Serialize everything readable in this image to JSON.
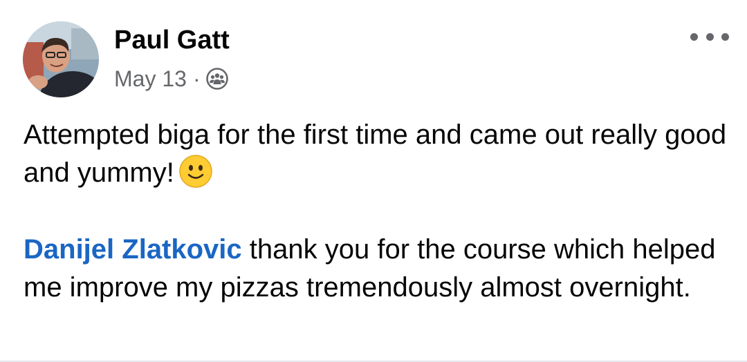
{
  "post": {
    "author": {
      "name": "Paul Gatt",
      "avatar_icon": "profile-photo"
    },
    "date": "May 13",
    "separator": "·",
    "audience_icon": "group-members-icon",
    "more_icon": "more-options-icon",
    "body": {
      "paragraph1": "Attempted biga for the first time and came out really good and yummy!",
      "paragraph1_emoji": "slightly-smiling-face",
      "mention": "Danijel Zlatkovic",
      "paragraph2": " thank you for the course which helped me improve my pizzas tremendously almost overnight."
    }
  },
  "colors": {
    "text": "#050505",
    "secondary_text": "#65676b",
    "mention": "#1a66c4",
    "divider": "#e4e6eb",
    "emoji_face": "#ffcc33"
  }
}
